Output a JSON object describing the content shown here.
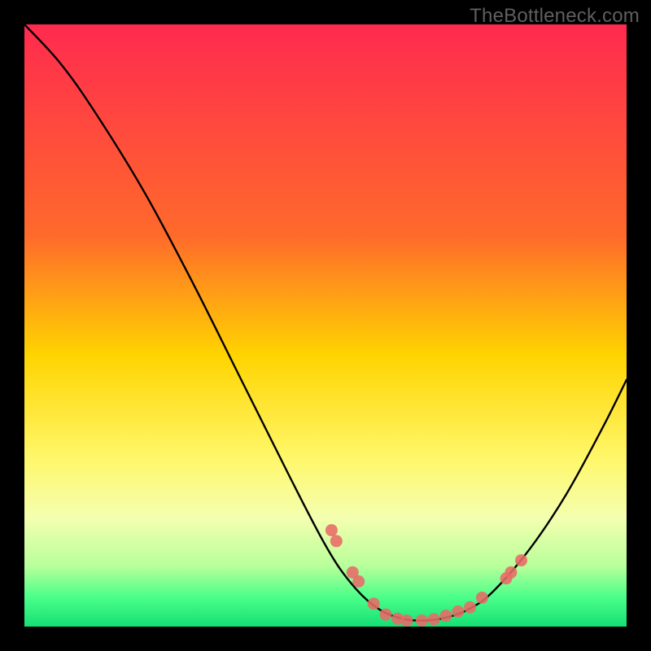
{
  "watermark": "TheBottleneck.com",
  "chart_data": {
    "type": "line",
    "title": "",
    "xlabel": "",
    "ylabel": "",
    "xlim": [
      0,
      100
    ],
    "ylim": [
      0,
      100
    ],
    "gradient_stops": [
      {
        "offset": 0,
        "color": "#ff2a4f"
      },
      {
        "offset": 35,
        "color": "#ff6a2b"
      },
      {
        "offset": 55,
        "color": "#ffd400"
      },
      {
        "offset": 72,
        "color": "#fff76a"
      },
      {
        "offset": 82,
        "color": "#f4ffb0"
      },
      {
        "offset": 90,
        "color": "#b7ff9a"
      },
      {
        "offset": 95,
        "color": "#4dff8a"
      },
      {
        "offset": 100,
        "color": "#14e074"
      }
    ],
    "series": [
      {
        "name": "curve",
        "type": "line",
        "smooth": true,
        "data": [
          {
            "x": 0.0,
            "y": 100.0
          },
          {
            "x": 6.0,
            "y": 93.5
          },
          {
            "x": 12.0,
            "y": 85.0
          },
          {
            "x": 20.0,
            "y": 72.0
          },
          {
            "x": 28.0,
            "y": 57.0
          },
          {
            "x": 36.0,
            "y": 41.0
          },
          {
            "x": 44.0,
            "y": 25.0
          },
          {
            "x": 50.0,
            "y": 13.5
          },
          {
            "x": 54.0,
            "y": 7.5
          },
          {
            "x": 58.0,
            "y": 3.5
          },
          {
            "x": 62.0,
            "y": 1.5
          },
          {
            "x": 66.0,
            "y": 1.0
          },
          {
            "x": 70.0,
            "y": 1.5
          },
          {
            "x": 74.0,
            "y": 3.0
          },
          {
            "x": 78.0,
            "y": 6.0
          },
          {
            "x": 84.0,
            "y": 13.0
          },
          {
            "x": 90.0,
            "y": 22.0
          },
          {
            "x": 96.0,
            "y": 33.0
          },
          {
            "x": 100.0,
            "y": 41.0
          }
        ]
      },
      {
        "name": "markers",
        "type": "scatter",
        "color": "#e96a67",
        "data": [
          {
            "x": 51.0,
            "y": 16.0
          },
          {
            "x": 51.8,
            "y": 14.2
          },
          {
            "x": 54.5,
            "y": 9.0
          },
          {
            "x": 55.5,
            "y": 7.5
          },
          {
            "x": 58.0,
            "y": 3.8
          },
          {
            "x": 60.0,
            "y": 2.0
          },
          {
            "x": 62.0,
            "y": 1.3
          },
          {
            "x": 63.5,
            "y": 1.0
          },
          {
            "x": 66.0,
            "y": 1.0
          },
          {
            "x": 68.0,
            "y": 1.2
          },
          {
            "x": 70.0,
            "y": 1.8
          },
          {
            "x": 72.0,
            "y": 2.5
          },
          {
            "x": 74.0,
            "y": 3.2
          },
          {
            "x": 76.0,
            "y": 4.8
          },
          {
            "x": 80.0,
            "y": 8.0
          },
          {
            "x": 80.8,
            "y": 9.0
          },
          {
            "x": 82.5,
            "y": 11.0
          }
        ]
      }
    ]
  }
}
